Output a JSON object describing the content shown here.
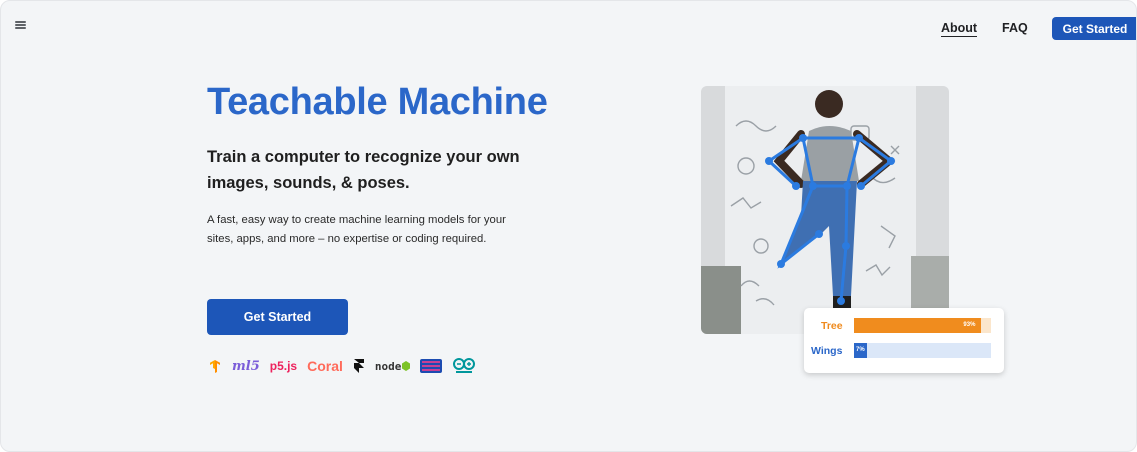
{
  "nav": {
    "menu_icon": "hamburger-menu-icon",
    "about": "About",
    "faq": "FAQ",
    "get_started": "Get Started"
  },
  "hero": {
    "title": "Teachable Machine",
    "subtitle": "Train a computer to recognize your own images, sounds, & poses.",
    "description": "A fast, easy way to create machine learning models for your sites, apps, and more – no expertise or coding required.",
    "cta": "Get Started"
  },
  "logos": [
    {
      "name": "tensorflow-logo",
      "text": ""
    },
    {
      "name": "ml5-logo",
      "text": "ml5"
    },
    {
      "name": "p5js-logo",
      "text": "p5.js"
    },
    {
      "name": "coral-logo",
      "text": "Coral"
    },
    {
      "name": "framer-logo",
      "text": ""
    },
    {
      "name": "node-logo",
      "text": "node"
    },
    {
      "name": "processing-logo",
      "text": ""
    },
    {
      "name": "arduino-logo",
      "text": ""
    }
  ],
  "predictions": [
    {
      "label": "Tree",
      "value": 0.93,
      "percent": "93%",
      "color": "#f08c1e"
    },
    {
      "label": "Wings",
      "value": 0.07,
      "percent": "7%",
      "color": "#2b67c9"
    }
  ],
  "colors": {
    "brand_blue": "#2b67c9",
    "button_blue": "#1d56b8",
    "orange": "#f08c1e"
  }
}
